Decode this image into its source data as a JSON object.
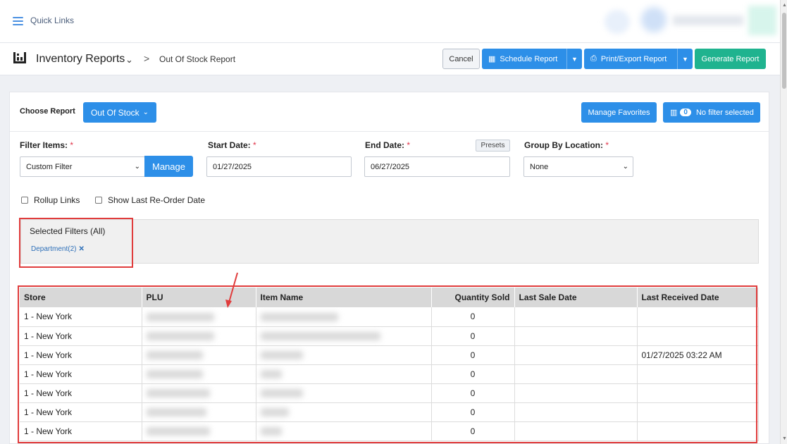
{
  "topbar": {
    "quick_links": "Quick Links"
  },
  "breadcrumb": {
    "module": "Inventory Reports",
    "separator": ">",
    "page": "Out Of Stock Report"
  },
  "actions": {
    "cancel": "Cancel",
    "schedule": "Schedule Report",
    "print_export": "Print/Export Report",
    "generate": "Generate Report"
  },
  "report": {
    "choose_label": "Choose Report",
    "choose_value": "Out Of Stock",
    "manage_favorites": "Manage Favorites",
    "filter_count": "0",
    "no_filter": "No filter selected"
  },
  "form": {
    "filter_items_label": "Filter Items:",
    "filter_items_value": "Custom Filter",
    "manage": "Manage",
    "start_date_label": "Start Date:",
    "start_date_value": "01/27/2025",
    "end_date_label": "End Date:",
    "end_date_value": "06/27/2025",
    "presets": "Presets",
    "group_by_label": "Group By Location:",
    "group_by_value": "None",
    "required_mark": "*",
    "rollup_links": "Rollup Links",
    "show_last_reorder": "Show Last Re-Order Date"
  },
  "selected_filters": {
    "title": "Selected Filters (All)",
    "tag": "Department(2)",
    "remove": "✕"
  },
  "table": {
    "headers": [
      "Store",
      "PLU",
      "Item Name",
      "Quantity Sold",
      "Last Sale Date",
      "Last Received Date"
    ],
    "rows": [
      {
        "store": "1 - New York",
        "qty": "0",
        "last_sale": "",
        "last_received": ""
      },
      {
        "store": "1 - New York",
        "qty": "0",
        "last_sale": "",
        "last_received": ""
      },
      {
        "store": "1 - New York",
        "qty": "0",
        "last_sale": "",
        "last_received": "01/27/2025 03:22 AM"
      },
      {
        "store": "1 - New York",
        "qty": "0",
        "last_sale": "",
        "last_received": ""
      },
      {
        "store": "1 - New York",
        "qty": "0",
        "last_sale": "",
        "last_received": ""
      },
      {
        "store": "1 - New York",
        "qty": "0",
        "last_sale": "",
        "last_received": ""
      },
      {
        "store": "1 - New York",
        "qty": "0",
        "last_sale": "",
        "last_received": ""
      }
    ]
  },
  "colors": {
    "primary": "#2d8fe8",
    "success": "#1fb38f",
    "annotation": "#e03c3c"
  }
}
